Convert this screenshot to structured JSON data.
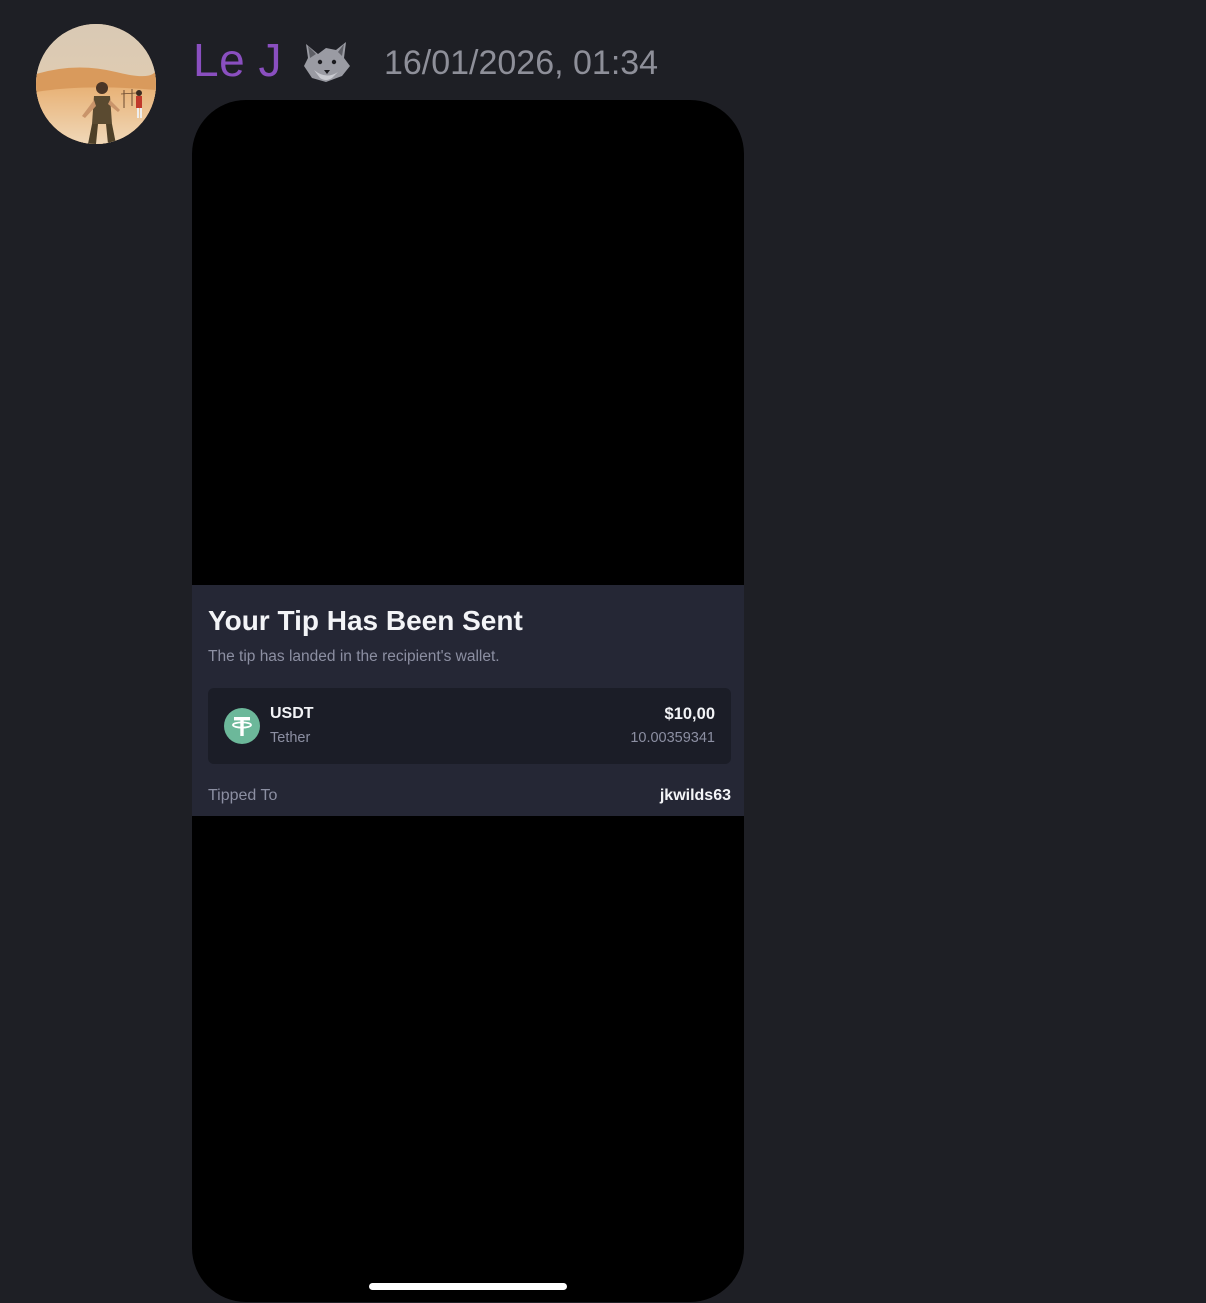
{
  "message": {
    "username": "Le J",
    "badge_icon": "wolf-emoji",
    "timestamp": "16/01/2026, 01:34",
    "colors": {
      "username": "#8a4fc0",
      "background": "#1e1f25"
    }
  },
  "tip_card": {
    "title": "Your Tip Has Been Sent",
    "subtitle": "The tip has landed in the recipient's wallet.",
    "coin": {
      "icon": "tether-icon",
      "symbol": "USDT",
      "name": "Tether",
      "usd_value": "$10,00",
      "amount": "10.00359341",
      "icon_color": "#6cb89a"
    },
    "tipped_to_label": "Tipped To",
    "recipient": "jkwilds63"
  }
}
